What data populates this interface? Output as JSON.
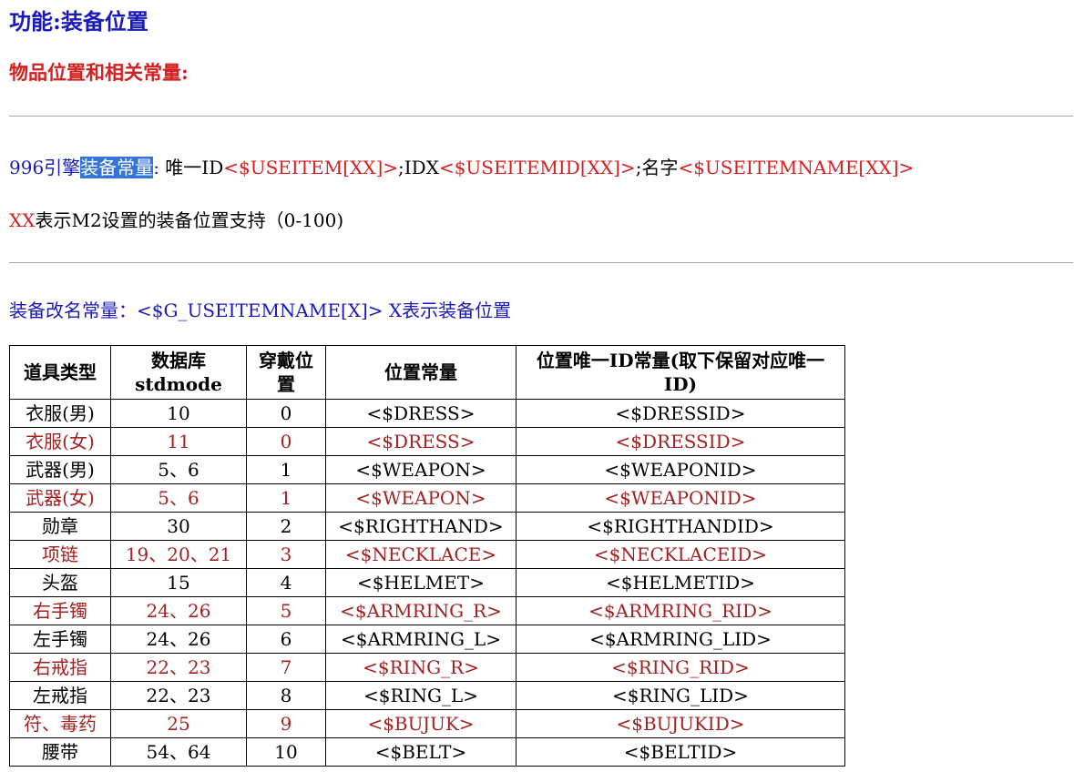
{
  "header": {
    "title": "功能:装备位置",
    "subtitle": "物品位置和相关常量:"
  },
  "engine_line": {
    "prefix": "996引擎",
    "highlight": "装备常量",
    "colon": ": ",
    "id_label": "唯一ID",
    "id_value": "<$USEITEM[XX]>",
    "sep1": ";IDX",
    "idx_value": "<$USEITEMID[XX]>",
    "sep2": ";名字",
    "name_value": "<$USEITEMNAME[XX]>"
  },
  "xx_line": {
    "xx": "XX",
    "text": "表示M2设置的装备位置支持（0-100)"
  },
  "rename_line": {
    "text": "装备改名常量：<$G_USEITEMNAME[X]> X表示装备位置"
  },
  "table": {
    "headers": [
      "道具类型",
      "数据库stdmode",
      "穿戴位置",
      "位置常量",
      "位置唯一ID常量(取下保留对应唯一ID)"
    ],
    "rows": [
      [
        "衣服(男)",
        "10",
        "0",
        "<$DRESS>",
        "<$DRESSID>"
      ],
      [
        "衣服(女)",
        "11",
        "0",
        "<$DRESS>",
        "<$DRESSID>"
      ],
      [
        "武器(男)",
        "5、6",
        "1",
        "<$WEAPON>",
        "<$WEAPONID>"
      ],
      [
        "武器(女)",
        "5、6",
        "1",
        "<$WEAPON>",
        "<$WEAPONID>"
      ],
      [
        "勋章",
        "30",
        "2",
        "<$RIGHTHAND>",
        "<$RIGHTHANDID>"
      ],
      [
        "项链",
        "19、20、21",
        "3",
        "<$NECKLACE>",
        "<$NECKLACEID>"
      ],
      [
        "头盔",
        "15",
        "4",
        "<$HELMET>",
        "<$HELMETID>"
      ],
      [
        "右手镯",
        "24、26",
        "5",
        "<$ARMRING_R>",
        "<$ARMRING_RID>"
      ],
      [
        "左手镯",
        "24、26",
        "6",
        "<$ARMRING_L>",
        "<$ARMRING_LID>"
      ],
      [
        "右戒指",
        "22、23",
        "7",
        "<$RING_R>",
        "<$RING_RID>"
      ],
      [
        "左戒指",
        "22、23",
        "8",
        "<$RING_L>",
        "<$RING_LID>"
      ],
      [
        "符、毒药",
        "25",
        "9",
        "<$BUJUK>",
        "<$BUJUKID>"
      ],
      [
        "腰带",
        "54、64",
        "10",
        "<$BELT>",
        "<$BELTID>"
      ]
    ]
  },
  "colors": {
    "title_blue": "#1a1ab8",
    "subtitle_red": "#d42020",
    "alt_row_red": "#a22222",
    "highlight_bg": "#3374d8"
  }
}
